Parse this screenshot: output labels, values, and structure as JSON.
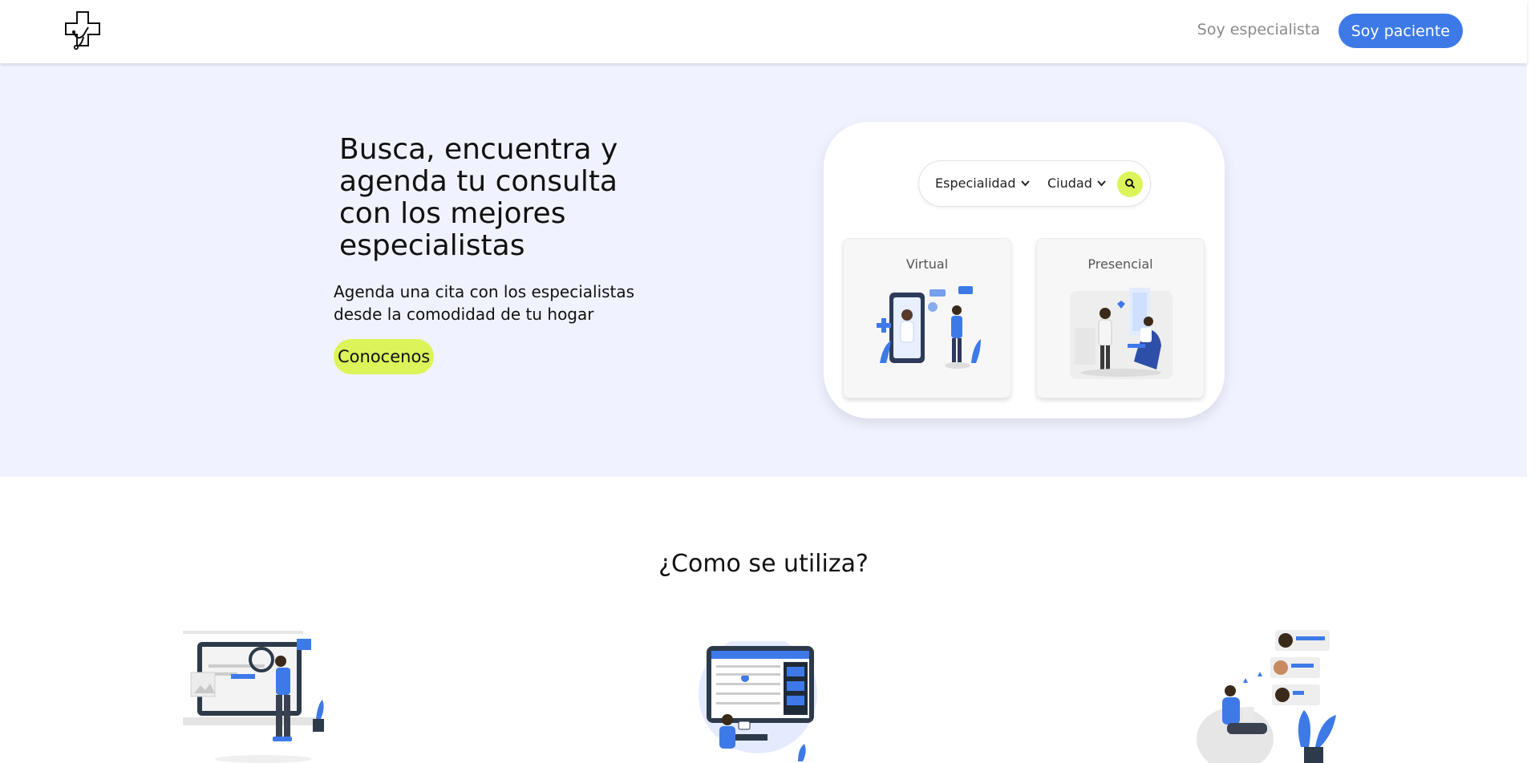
{
  "header": {
    "logo_icon": "medical-cross-stethoscope-icon",
    "nav_specialist": "Soy especialista",
    "nav_patient": "Soy paciente"
  },
  "hero": {
    "title": "Busca, encuentra y agenda tu consulta con los mejores especialistas",
    "subtitle": "Agenda una cita con los especialistas desde la comodidad de tu hogar",
    "cta": "Conocenos"
  },
  "search": {
    "specialty_placeholder": "Especialidad",
    "city_placeholder": "Ciudad",
    "search_icon": "search-icon"
  },
  "modes": [
    {
      "label": "Virtual"
    },
    {
      "label": "Presencial"
    }
  ],
  "how": {
    "title": "¿Como se utiliza?"
  },
  "colors": {
    "primary": "#3d7ae8",
    "accent": "#dcf45a",
    "hero_bg": "#f0f3ff"
  }
}
